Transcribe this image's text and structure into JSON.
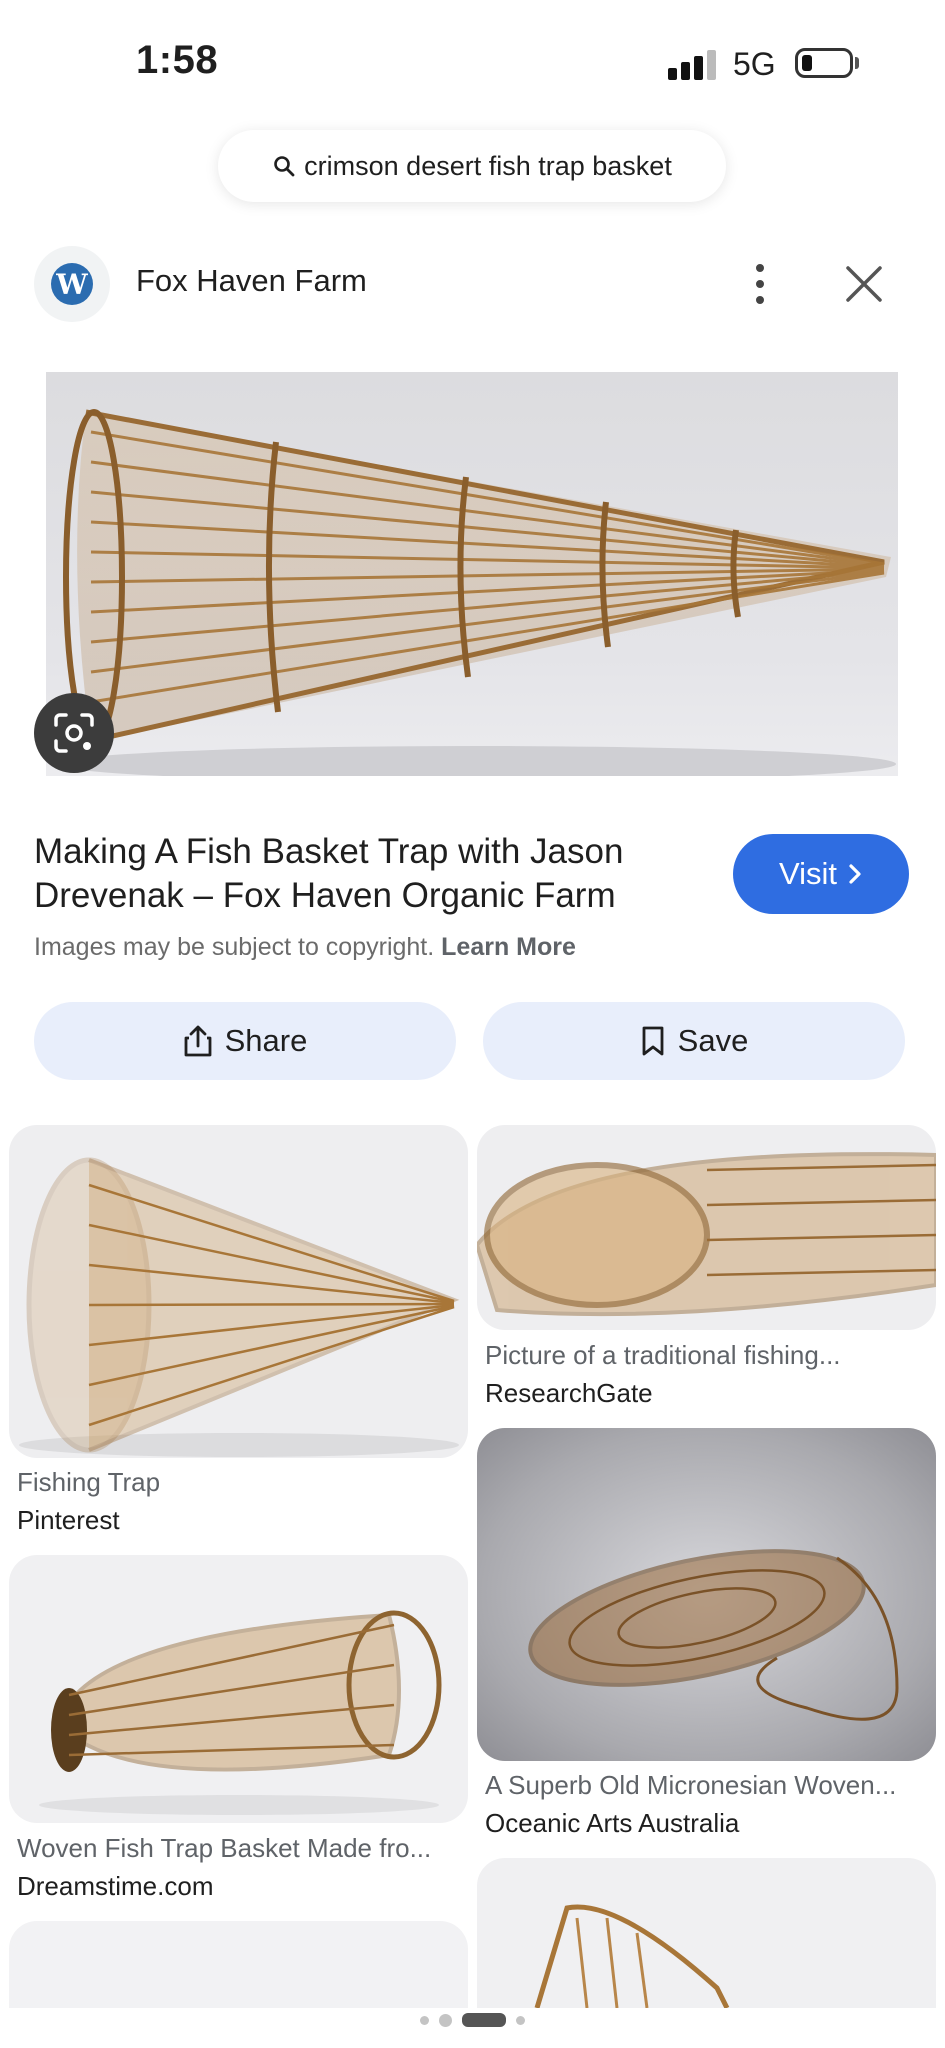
{
  "status_bar": {
    "time": "1:58",
    "network": "5G"
  },
  "search": {
    "query": "crimson desert fish trap basket"
  },
  "source": {
    "name": "Fox Haven Farm",
    "logo_icon": "wordpress-icon"
  },
  "result": {
    "title": "Making A Fish Basket Trap with Jason Drevenak – Fox Haven Organic Farm",
    "visit_label": "Visit",
    "copyright_text": "Images may be subject to copyright.",
    "learn_more": "Learn More"
  },
  "actions": {
    "share_label": "Share",
    "save_label": "Save"
  },
  "related": [
    {
      "title": "Fishing Trap",
      "source": "Pinterest"
    },
    {
      "title": "Picture of a traditional fishing...",
      "source": "ResearchGate"
    },
    {
      "title": "Woven Fish Trap Basket Made fro...",
      "source": "Dreamstime.com"
    },
    {
      "title": "A Superb Old Micronesian Woven...",
      "source": "Oceanic Arts Australia"
    }
  ],
  "colors": {
    "accent": "#2f6de1",
    "action_bg": "#e8eefb",
    "basket": "#b8864a"
  }
}
